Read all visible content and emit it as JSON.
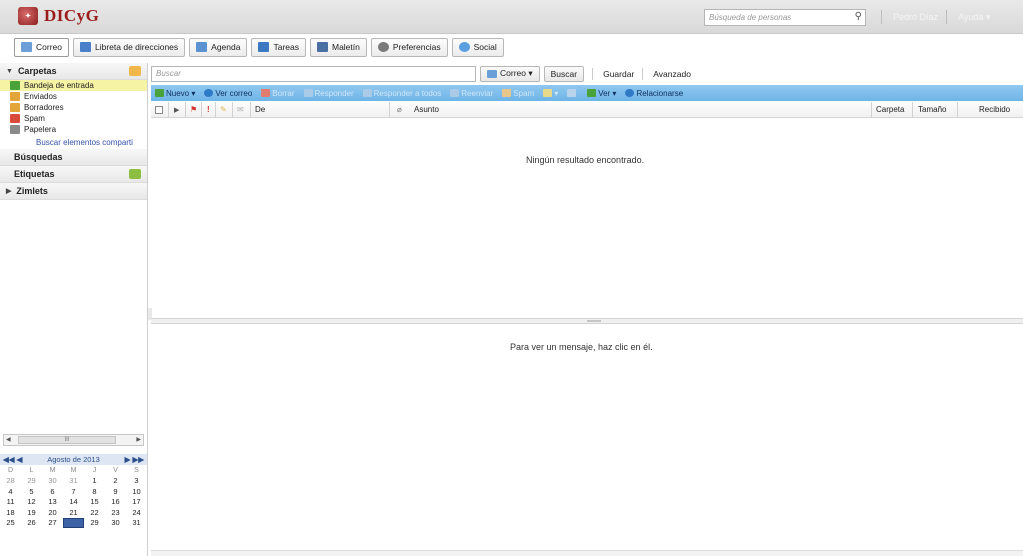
{
  "app": {
    "logo_text": "DICyG",
    "logo_mark": "DICyG"
  },
  "header": {
    "people_search_placeholder": "Búsqueda de personas",
    "user_name": "Pedro Díaz",
    "help_label": "Ayuda ▾"
  },
  "app_tabs": [
    {
      "label": "Correo",
      "icon": "mail-icon",
      "color": "#6c9fd8"
    },
    {
      "label": "Libreta de direcciones",
      "icon": "addressbook-icon",
      "color": "#4a7fc9"
    },
    {
      "label": "Agenda",
      "icon": "calendar-icon",
      "color": "#5b93d2"
    },
    {
      "label": "Tareas",
      "icon": "tasks-icon",
      "color": "#3d78c2"
    },
    {
      "label": "Maletín",
      "icon": "briefcase-icon",
      "color": "#4c6fa3"
    },
    {
      "label": "Preferencias",
      "icon": "gear-icon",
      "color": "#7a7a7a"
    },
    {
      "label": "Social",
      "icon": "social-icon",
      "color": "#5aa0e0"
    }
  ],
  "sidebar": {
    "folders_header": "Carpetas",
    "folders": [
      {
        "label": "Bandeja de entrada",
        "icon": "inbox-icon",
        "color": "#4aa33a",
        "selected": true
      },
      {
        "label": "Enviados",
        "icon": "sent-icon",
        "color": "#e3a53a"
      },
      {
        "label": "Borradores",
        "icon": "drafts-icon",
        "color": "#e3a53a"
      },
      {
        "label": "Spam",
        "icon": "spam-icon",
        "color": "#d84a3a"
      },
      {
        "label": "Papelera",
        "icon": "trash-icon",
        "color": "#8a8a8a"
      }
    ],
    "shared_link": "Buscar elementos comparti",
    "searches_header": "Búsquedas",
    "tags_header": "Etiquetas",
    "zimlets_header": "Zimlets",
    "hscroll_thumb": "III"
  },
  "calendar": {
    "title": "Agosto de 2013",
    "nav_prev": "◀◀  ◀",
    "nav_next": "▶  ▶▶",
    "dow": [
      "D",
      "L",
      "M",
      "M",
      "J",
      "V",
      "S"
    ],
    "weeks": [
      [
        "28",
        "29",
        "30",
        "31",
        "1",
        "2",
        "3"
      ],
      [
        "4",
        "5",
        "6",
        "7",
        "8",
        "9",
        "10"
      ],
      [
        "11",
        "12",
        "13",
        "14",
        "15",
        "16",
        "17"
      ],
      [
        "18",
        "19",
        "20",
        "21",
        "22",
        "23",
        "24"
      ],
      [
        "25",
        "26",
        "27",
        "28",
        "29",
        "30",
        "31"
      ]
    ],
    "other_month_count_first_week": 4,
    "today": "28"
  },
  "search": {
    "placeholder": "Buscar",
    "scope_label": "Correo ▾",
    "search_button": "Buscar",
    "save_link": "Guardar",
    "advanced_link": "Avanzado"
  },
  "toolbar": {
    "new_label": "Nuevo ▾",
    "check_mail": "Ver correo",
    "delete": "Borrar",
    "reply": "Responder",
    "reply_all": "Responder a todos",
    "forward": "Reenviar",
    "spam": "Spam",
    "view": "Ver ▾",
    "relate": "Relacionarse"
  },
  "list_header": {
    "from": "De",
    "subject": "Asunto",
    "folder": "Carpeta",
    "size": "Tamaño",
    "received": "Recibido"
  },
  "messages": {
    "empty": "Ningún resultado encontrado.",
    "reading_hint": "Para ver un mensaje, haz clic en él."
  }
}
